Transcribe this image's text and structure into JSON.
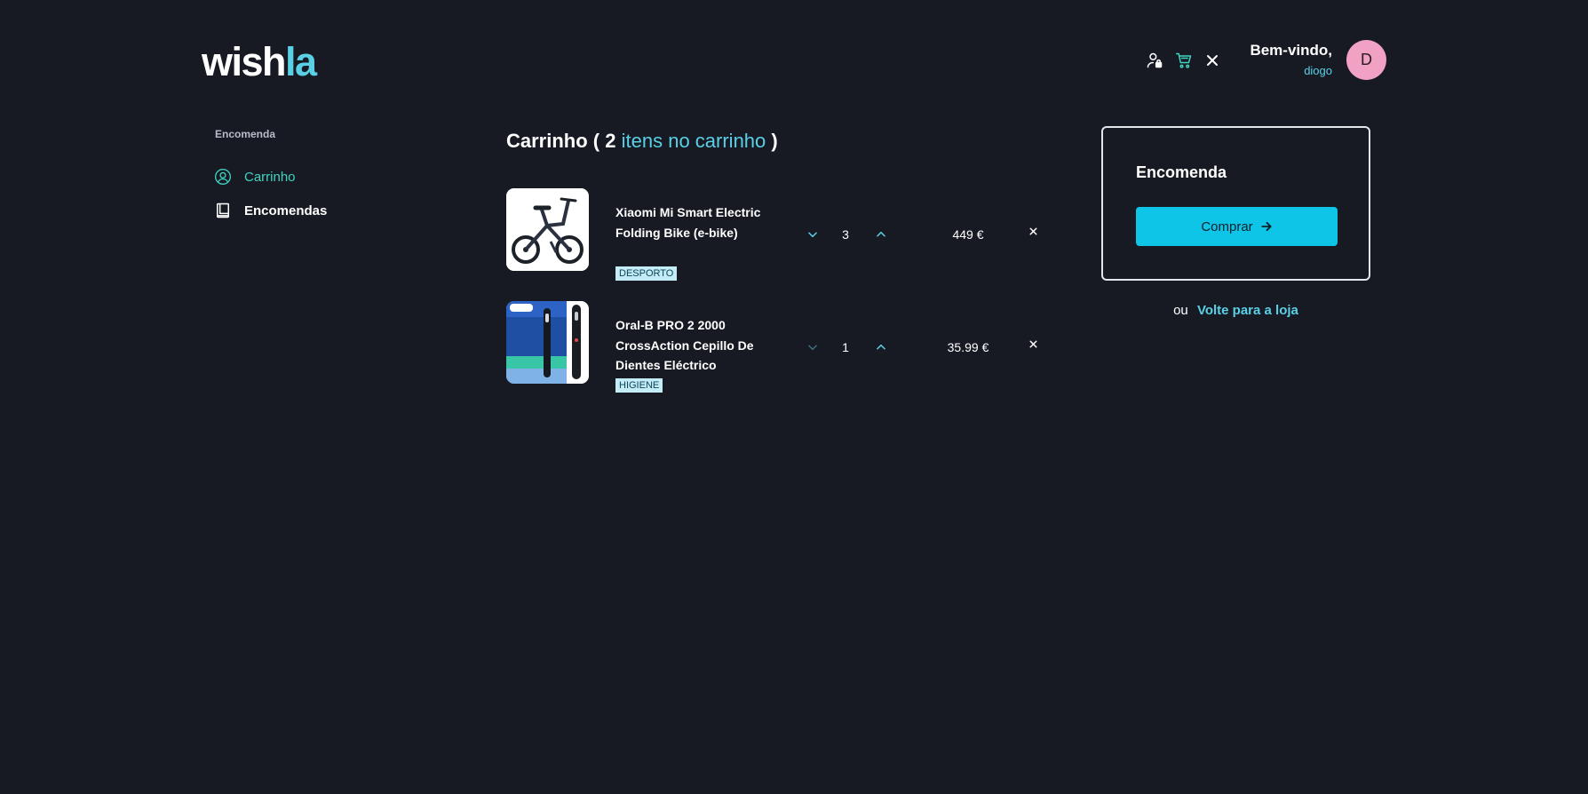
{
  "brand": {
    "part1": "wish",
    "part2": "la"
  },
  "header": {
    "welcome": "Bem-vindo,",
    "username": "diogo",
    "avatar_initial": "D"
  },
  "sidebar": {
    "heading": "Encomenda",
    "items": [
      {
        "label": "Carrinho",
        "icon": "user-circle-icon",
        "active": true
      },
      {
        "label": "Encomendas",
        "icon": "book-icon",
        "active": false
      }
    ]
  },
  "cart": {
    "title_prefix": "Carrinho (",
    "count": "2",
    "title_accent": "itens no carrinho",
    "title_suffix": ")",
    "items": [
      {
        "name": "Xiaomi Mi Smart Electric Folding Bike (e-bike)",
        "category": "DESPORTO",
        "quantity": "3",
        "price": "449 €"
      },
      {
        "name": "Oral-B PRO 2 2000 CrossAction Cepillo De Dientes Eléctrico",
        "category": "HIGIENE",
        "quantity": "1",
        "price": "35.99 €"
      }
    ]
  },
  "order": {
    "title": "Encomenda",
    "buy_label": "Comprar",
    "or_label": "ou",
    "back_link": "Volte para a loja"
  },
  "colors": {
    "background": "#171a23",
    "accent": "#5ad0e6",
    "teal": "#3fd3c2",
    "button": "#0ec5e8",
    "avatar": "#f1a1c4",
    "tag_bg": "#c4ecf6"
  }
}
